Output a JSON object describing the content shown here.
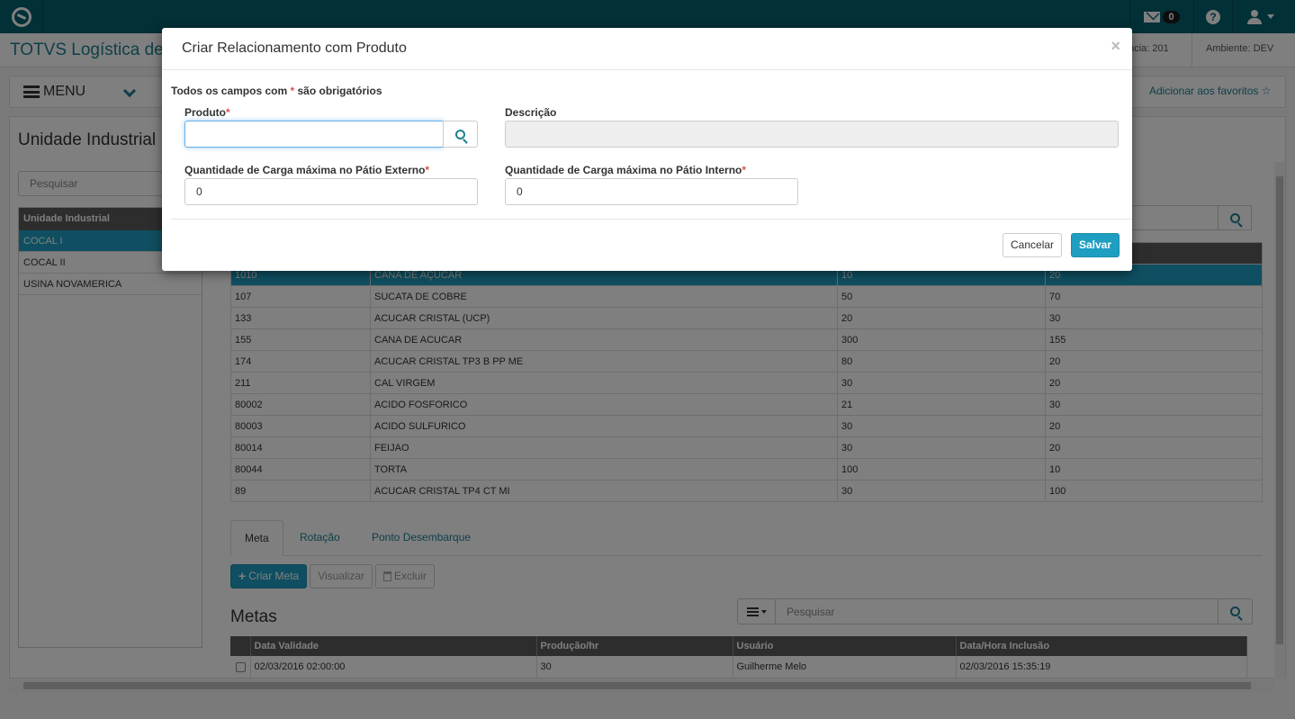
{
  "topbar": {
    "mail_count": "0"
  },
  "header": {
    "app_title": "TOTVS Logística de",
    "instance_text": "ância: 201",
    "environment": "Ambiente: DEV"
  },
  "menubar": {
    "menu_label": "MENU",
    "favorites_label": "Adicionar aos favoritos ☆"
  },
  "page": {
    "title": "Unidade Industrial",
    "search_placeholder": "Pesquisar",
    "units_header": "Unidade Industrial",
    "units": [
      "COCAL I",
      "COCAL II",
      "USINA NOVAMERICA"
    ]
  },
  "products_grid": {
    "rows": [
      [
        "1010",
        "CANA DE AÇUCAR",
        "10",
        "20"
      ],
      [
        "107",
        "SUCATA DE COBRE",
        "50",
        "70"
      ],
      [
        "133",
        "ACUCAR CRISTAL (UCP)",
        "20",
        "30"
      ],
      [
        "155",
        "CANA DE ACUCAR",
        "300",
        "155"
      ],
      [
        "174",
        "ACUCAR CRISTAL TP3 B PP ME",
        "80",
        "20"
      ],
      [
        "211",
        "CAL VIRGEM",
        "30",
        "20"
      ],
      [
        "80002",
        "ACIDO FOSFORICO",
        "21",
        "30"
      ],
      [
        "80003",
        "ACIDO SULFURICO",
        "30",
        "20"
      ],
      [
        "80014",
        "FEIJAO",
        "30",
        "20"
      ],
      [
        "80044",
        "TORTA",
        "100",
        "10"
      ],
      [
        "89",
        "ACUCAR CRISTAL TP4 CT MI",
        "30",
        "100"
      ]
    ]
  },
  "tabs": [
    "Meta",
    "Rotação",
    "Ponto Desembarque"
  ],
  "actions": {
    "create": "Criar Meta",
    "view": "Visualizar",
    "delete": "Excluir"
  },
  "metas": {
    "title": "Metas",
    "search_placeholder": "Pesquisar",
    "headers": [
      "Data Validade",
      "Produção/hr",
      "Usuário",
      "Data/Hora Inclusão"
    ],
    "rows": [
      [
        "02/03/2016 02:00:00",
        "30",
        "Guilherme Melo",
        "02/03/2016 15:35:19"
      ]
    ]
  },
  "modal": {
    "title": "Criar Relacionamento com Produto",
    "close": "×",
    "required_note_pre": "Todos os campos com ",
    "required_star": "*",
    "required_note_post": " são obrigatórios",
    "produto_label": "Produto",
    "produto_value": "",
    "descricao_label": "Descrição",
    "descricao_value": "",
    "externo_label": "Quantidade de Carga máxima no Pátio Externo",
    "externo_value": "0",
    "interno_label": "Quantidade de Carga máxima no Pátio Interno",
    "interno_value": "0",
    "cancel": "Cancelar",
    "save": "Salvar"
  }
}
